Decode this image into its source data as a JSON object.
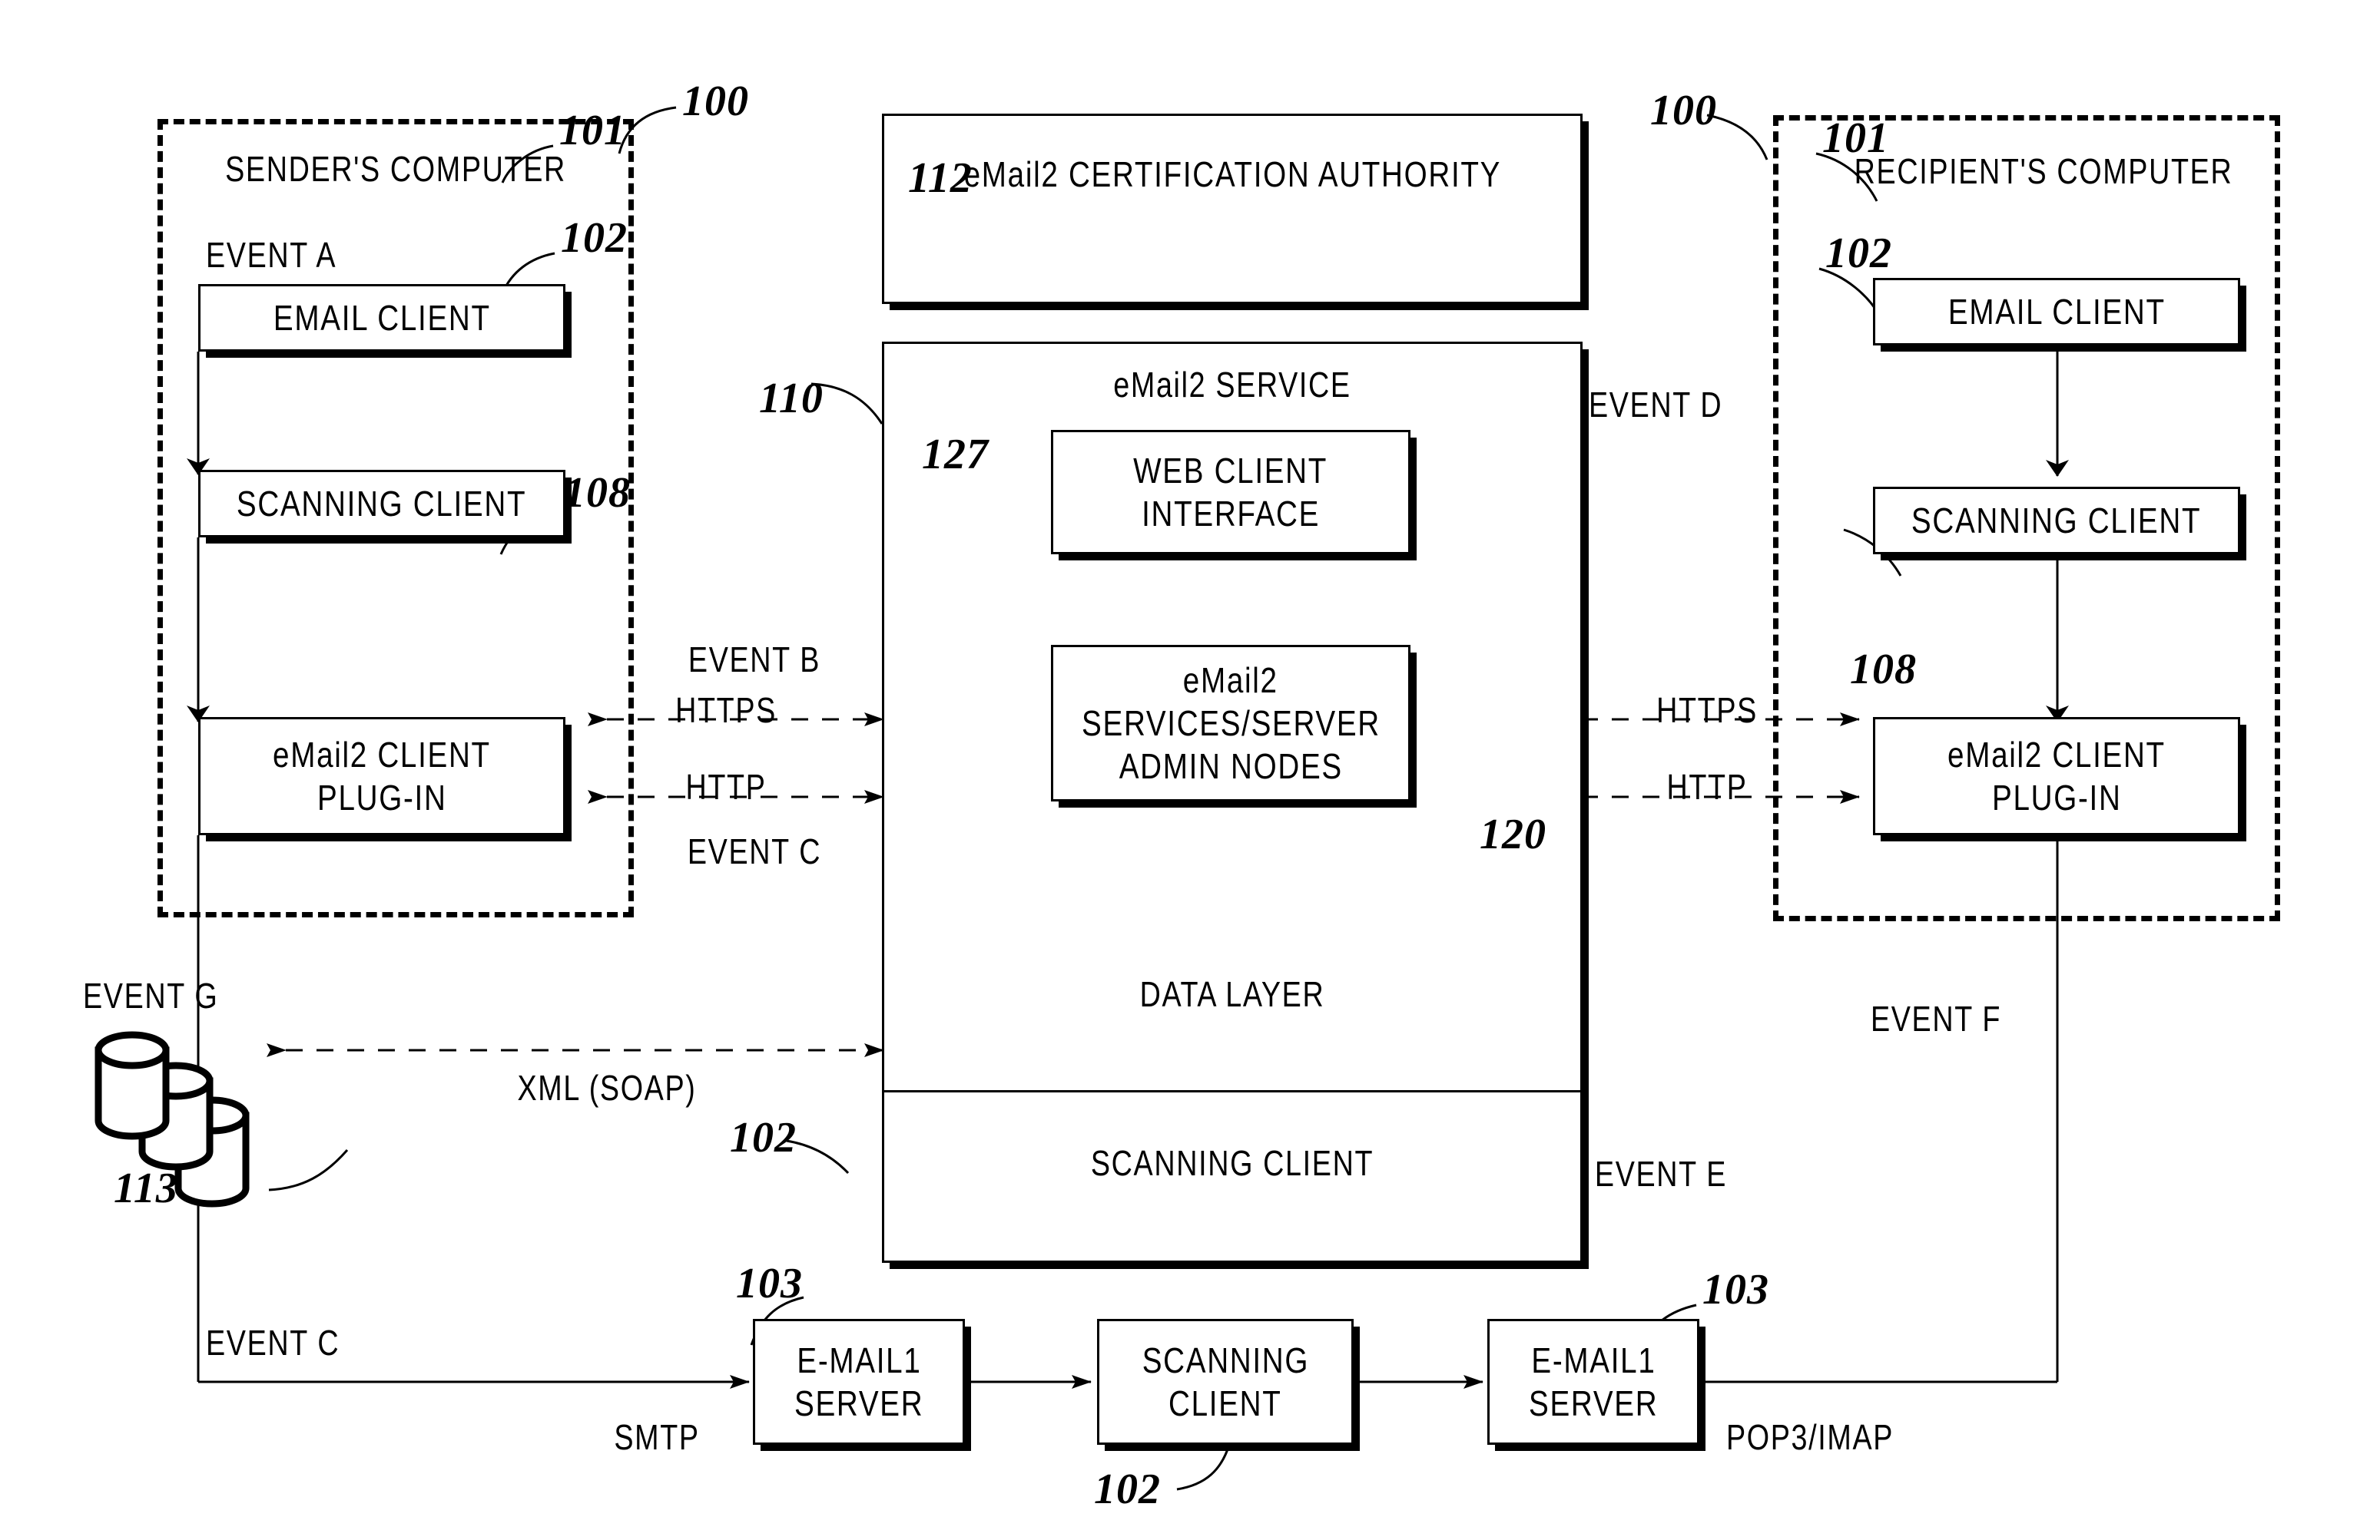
{
  "figure": {
    "sender_panel": {
      "title": "SENDER'S COMPUTER",
      "ref": "100",
      "boxes": [
        {
          "ref": "101",
          "label": "EMAIL CLIENT"
        },
        {
          "ref": "102",
          "label": "SCANNING CLIENT"
        },
        {
          "ref": "108",
          "label": "eMail2 CLIENT\nPLUG-IN"
        }
      ],
      "event_label": "EVENT A"
    },
    "recipient_panel": {
      "title": "RECIPIENT'S COMPUTER",
      "ref": "100",
      "boxes": [
        {
          "ref": "101",
          "label": "EMAIL CLIENT"
        },
        {
          "ref": "102",
          "label": "SCANNING CLIENT"
        },
        {
          "ref": "108",
          "label": "eMail2 CLIENT\nPLUG-IN"
        }
      ],
      "event_label": "EVENT D"
    },
    "certification_authority": {
      "ref": "112",
      "title": "eMail2 CERTIFICATION AUTHORITY",
      "icon": "database-cylinder-icon"
    },
    "service": {
      "ref": "110",
      "title": "eMail2 SERVICE",
      "web_client_interface": {
        "ref": "127",
        "label": "WEB CLIENT\nINTERFACE"
      },
      "admin_nodes": {
        "label": "eMail2\nSERVICES/SERVER\nADMIN NODES"
      },
      "data_layer": {
        "ref": "120",
        "label": "DATA LAYER",
        "icon": "database-cylinder-icon"
      },
      "scanning_client": {
        "ref": "102",
        "label": "SCANNING CLIENT"
      }
    },
    "external_stores": {
      "ref": "113",
      "event_label": "EVENT G",
      "icon": "database-cylinder-stack-icon",
      "count": 3
    },
    "bottom_row": [
      {
        "ref": "103",
        "label": "E-MAIL1\nSERVER"
      },
      {
        "ref": "102",
        "label": "SCANNING\nCLIENT"
      },
      {
        "ref": "103",
        "label": "E-MAIL1\nSERVER"
      }
    ],
    "protocol_labels": {
      "left_https": "HTTPS",
      "left_http": "HTTP",
      "right_https": "HTTPS",
      "right_http": "HTTP",
      "xml_soap": "XML (SOAP)",
      "smtp": "SMTP",
      "pop3_imap": "POP3/IMAP"
    },
    "event_labels": {
      "a": "EVENT A",
      "b": "EVENT B",
      "c_top": "EVENT C",
      "c_bottom": "EVENT C",
      "d": "EVENT D",
      "e": "EVENT E",
      "f": "EVENT F",
      "g": "EVENT G"
    },
    "colors": {
      "ink": "#000000",
      "paper": "#ffffff"
    }
  }
}
